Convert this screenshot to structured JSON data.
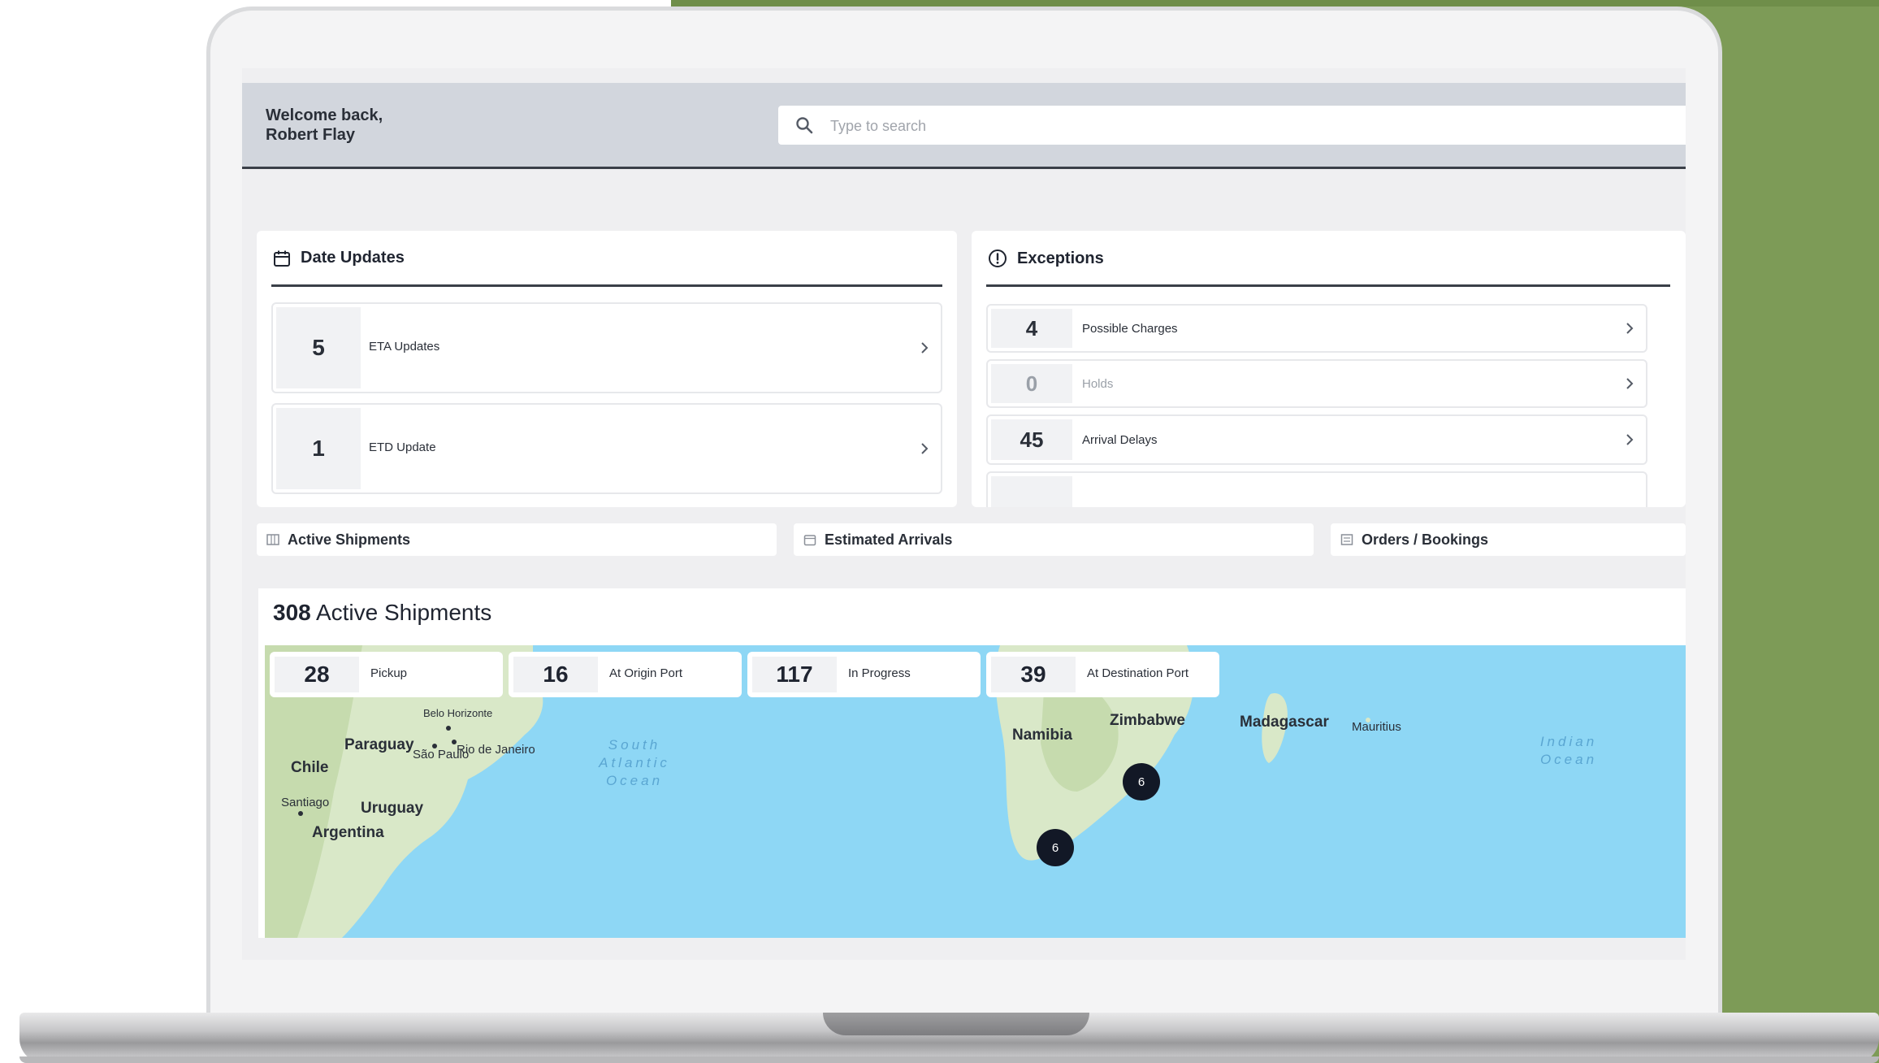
{
  "header": {
    "welcome_line1": "Welcome back,",
    "welcome_line2": "Robert Flay",
    "search_placeholder": "Type to search"
  },
  "date_updates": {
    "title": "Date Updates",
    "items": [
      {
        "count": "5",
        "label": "ETA Updates"
      },
      {
        "count": "1",
        "label": "ETD Update"
      }
    ]
  },
  "exceptions": {
    "title": "Exceptions",
    "items": [
      {
        "count": "4",
        "label": "Possible Charges"
      },
      {
        "count": "0",
        "label": "Holds"
      },
      {
        "count": "45",
        "label": "Arrival Delays"
      }
    ]
  },
  "tabs": [
    {
      "label": "Active Shipments"
    },
    {
      "label": "Estimated Arrivals"
    },
    {
      "label": "Orders / Bookings"
    }
  ],
  "active_shipments": {
    "count": "308",
    "title_suffix": "Active Shipments",
    "stats": [
      {
        "count": "28",
        "label": "Pickup"
      },
      {
        "count": "16",
        "label": "At Origin Port"
      },
      {
        "count": "117",
        "label": "In Progress"
      },
      {
        "count": "39",
        "label": "At Destination Port"
      }
    ]
  },
  "map": {
    "places": {
      "belo_horizonte": "Belo Horizonte",
      "paraguay": "Paraguay",
      "sao_paulo": "São Paulo",
      "rio": "Rio de Janeiro",
      "chile": "Chile",
      "santiago": "Santiago",
      "uruguay": "Uruguay",
      "argentina": "Argentina",
      "namibia": "Namibia",
      "zimbabwe": "Zimbabwe",
      "madagascar": "Madagascar",
      "mauritius": "Mauritius"
    },
    "oceans": {
      "south_atlantic": [
        "South",
        "Atlantic",
        "Ocean"
      ],
      "indian": [
        "Indian",
        "Ocean"
      ]
    },
    "clusters": [
      "6",
      "6"
    ]
  },
  "colors": {
    "brand_green": "#7d9b57",
    "header_bg": "#d2d6dd",
    "map_water": "#8ed7f5",
    "cluster": "#121826"
  }
}
